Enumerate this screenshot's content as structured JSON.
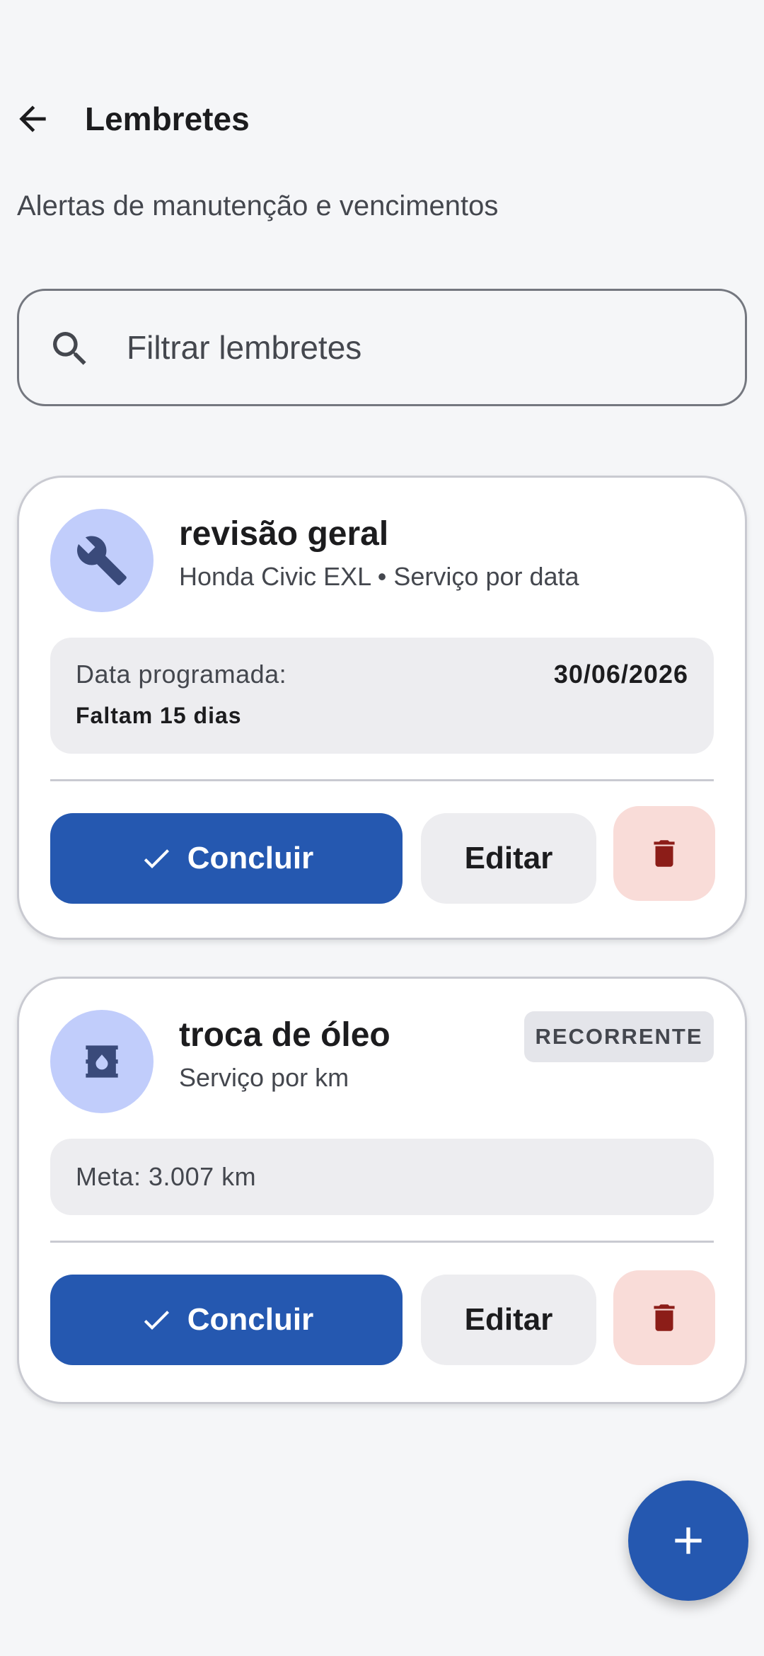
{
  "header": {
    "title": "Lembretes",
    "subtitle": "Alertas de manutenção e vencimentos"
  },
  "search": {
    "placeholder": "Filtrar lembretes",
    "value": ""
  },
  "reminders": [
    {
      "icon": "wrench-icon",
      "title": "revisão geral",
      "subtitle": "Honda Civic EXL • Serviço por data",
      "badge": null,
      "info_label": "Data programada:",
      "info_value": "30/06/2026",
      "info_note": "Faltam 15 dias",
      "complete_label": "Concluir",
      "edit_label": "Editar"
    },
    {
      "icon": "oil-drum-icon",
      "title": "troca de óleo",
      "subtitle": "Serviço por km",
      "badge": "RECORRENTE",
      "info_label": "Meta: 3.007 km",
      "complete_label": "Concluir",
      "edit_label": "Editar"
    }
  ],
  "fab": {
    "icon": "plus-icon"
  },
  "colors": {
    "primary": "#2558b0",
    "avatar_bg": "#c1cdfb",
    "icon_fg": "#3a4a7a",
    "delete_bg": "#f9dcd8",
    "delete_fg": "#8c1d18",
    "background": "#f5f6f8"
  }
}
